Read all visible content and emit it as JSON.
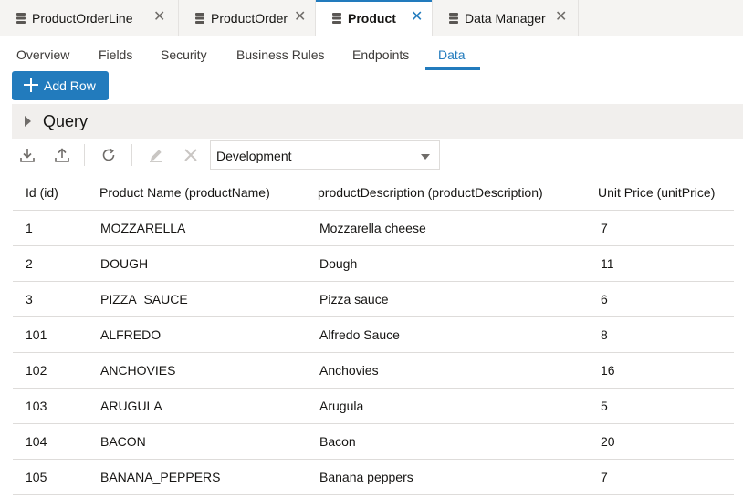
{
  "doc_tabs": [
    {
      "label": "ProductOrderLine",
      "icon": "database-icon",
      "active": false
    },
    {
      "label": "ProductOrder",
      "icon": "database-icon",
      "active": false
    },
    {
      "label": "Product",
      "icon": "database-icon",
      "active": true
    },
    {
      "label": "Data Manager",
      "icon": "database-icon",
      "active": false
    }
  ],
  "close_glyph": "✕",
  "sub_tabs": [
    "Overview",
    "Fields",
    "Security",
    "Business Rules",
    "Endpoints",
    "Data"
  ],
  "active_sub_tab": "Data",
  "add_row_label": "Add Row",
  "query_label": "Query",
  "toolbar": {
    "icons": [
      "download-icon",
      "upload-icon",
      "refresh-icon",
      "edit-icon",
      "delete-icon"
    ],
    "environment": "Development"
  },
  "table": {
    "columns": [
      "Id (id)",
      "Product Name (productName)",
      "productDescription (productDescription)",
      "Unit Price (unitPrice)"
    ],
    "rows": [
      [
        "1",
        "MOZZARELLA",
        "Mozzarella cheese",
        "7"
      ],
      [
        "2",
        "DOUGH",
        "Dough",
        "11"
      ],
      [
        "3",
        "PIZZA_SAUCE",
        "Pizza sauce",
        "6"
      ],
      [
        "101",
        "ALFREDO",
        "Alfredo Sauce",
        "8"
      ],
      [
        "102",
        "ANCHOVIES",
        "Anchovies",
        "16"
      ],
      [
        "103",
        "ARUGULA",
        "Arugula",
        "5"
      ],
      [
        "104",
        "BACON",
        "Bacon",
        "20"
      ],
      [
        "105",
        "BANANA_PEPPERS",
        "Banana peppers",
        "7"
      ]
    ]
  },
  "colors": {
    "accent": "#227bbd",
    "header_bg": "#f5f4f2",
    "query_bg": "#f1efed",
    "divider": "#dedcda"
  }
}
